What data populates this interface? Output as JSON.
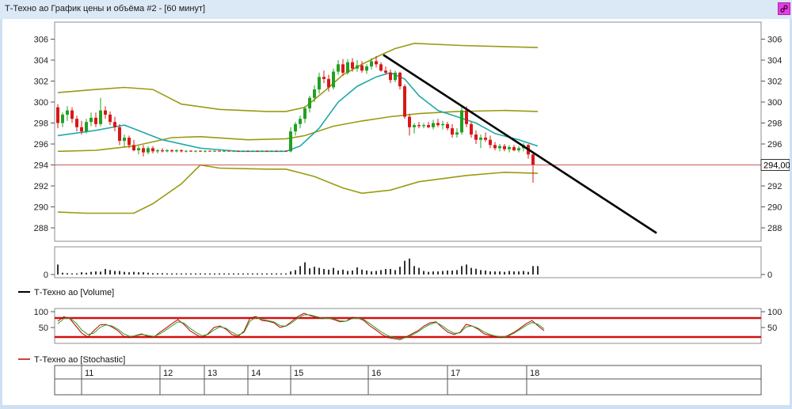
{
  "window": {
    "title": "Т-Техно ао График цены и объёма #2 - [60 минут]",
    "link_icon": "chain-link-icon",
    "link_color": "#e13fe0"
  },
  "price_panel": {
    "y_ticks": [
      "306",
      "304",
      "302",
      "300",
      "298",
      "296",
      "294",
      "292",
      "290",
      "288"
    ],
    "last_price_label": "294,00",
    "last_price_color": "#c45a5a"
  },
  "volume_panel": {
    "y_ticks": [
      "0"
    ],
    "legend_label": "Т-Техно ао [Volume]",
    "legend_color": "#000000"
  },
  "stochastic_panel": {
    "y_ticks": [
      "100",
      "50"
    ],
    "upper_level": 80,
    "lower_level": 20,
    "level_color": "#d21010",
    "legend_label": "Т-Техно ао [Stochastic]",
    "legend_color": "#c00000"
  },
  "time_axis": {
    "labels": [
      "11",
      "12",
      "13",
      "14",
      "15",
      "16",
      "17",
      "18"
    ]
  },
  "chart_data": [
    {
      "type": "candlestick",
      "title": "",
      "y_range": [
        287.5,
        307
      ],
      "x_categories": [
        "11",
        "12",
        "13",
        "14",
        "15",
        "16",
        "17",
        "18"
      ],
      "colors": {
        "up": "#22a022",
        "down": "#d81818",
        "ma": "#22a8a8",
        "bollinger": "#9a9a12",
        "trendline": "#000000"
      },
      "last_price": 294.0,
      "candles_ohlc": [
        [
          299.5,
          299.8,
          297.5,
          298.0
        ],
        [
          298.0,
          299.0,
          297.6,
          298.8
        ],
        [
          298.8,
          299.6,
          298.2,
          299.2
        ],
        [
          299.2,
          299.5,
          298.0,
          298.4
        ],
        [
          298.4,
          298.7,
          297.2,
          297.6
        ],
        [
          297.6,
          298.2,
          296.9,
          297.2
        ],
        [
          297.2,
          298.4,
          297.0,
          298.1
        ],
        [
          298.1,
          299.0,
          297.7,
          298.5
        ],
        [
          298.5,
          299.0,
          297.6,
          297.9
        ],
        [
          297.9,
          300.4,
          297.7,
          299.2
        ],
        [
          299.2,
          299.6,
          298.4,
          298.8
        ],
        [
          298.8,
          299.1,
          297.8,
          298.1
        ],
        [
          298.1,
          298.6,
          297.2,
          297.6
        ],
        [
          297.6,
          297.9,
          295.9,
          296.3
        ],
        [
          296.3,
          296.9,
          295.7,
          296.6
        ],
        [
          296.6,
          296.8,
          295.6,
          295.9
        ],
        [
          295.9,
          296.4,
          295.3,
          295.4
        ],
        [
          295.4,
          295.8,
          295.0,
          295.6
        ],
        [
          295.6,
          295.9,
          294.8,
          295.2
        ],
        [
          295.2,
          295.8,
          295.0,
          295.6
        ],
        [
          295.6,
          295.8,
          295.1,
          295.3
        ],
        [
          295.3,
          295.5,
          295.1,
          295.4
        ],
        [
          295.4,
          295.6,
          295.2,
          295.3
        ],
        [
          295.3,
          295.5,
          295.2,
          295.4
        ],
        [
          295.4,
          295.5,
          295.2,
          295.3
        ],
        [
          295.3,
          295.5,
          295.2,
          295.4
        ],
        [
          295.4,
          295.5,
          295.2,
          295.3
        ],
        [
          295.3,
          295.4,
          295.2,
          295.35
        ],
        [
          295.35,
          295.4,
          295.25,
          295.3
        ],
        [
          295.3,
          295.4,
          295.2,
          295.35
        ],
        [
          295.35,
          295.4,
          295.25,
          295.3
        ],
        [
          295.3,
          295.4,
          295.2,
          295.35
        ],
        [
          295.35,
          295.4,
          295.3,
          295.3
        ],
        [
          295.3,
          295.4,
          295.25,
          295.35
        ],
        [
          295.35,
          295.4,
          295.3,
          295.3
        ],
        [
          295.3,
          295.4,
          295.25,
          295.35
        ],
        [
          295.35,
          295.4,
          295.3,
          295.3
        ],
        [
          295.3,
          295.4,
          295.25,
          295.35
        ],
        [
          295.35,
          295.4,
          295.3,
          295.3
        ],
        [
          295.3,
          295.4,
          295.25,
          295.35
        ],
        [
          295.35,
          295.4,
          295.3,
          295.3
        ],
        [
          295.3,
          295.4,
          295.25,
          295.35
        ],
        [
          295.35,
          295.4,
          295.3,
          295.3
        ],
        [
          295.3,
          295.4,
          295.25,
          295.35
        ],
        [
          295.35,
          295.4,
          295.3,
          295.3
        ],
        [
          295.3,
          295.4,
          295.25,
          295.35
        ],
        [
          295.35,
          295.4,
          295.3,
          295.3
        ],
        [
          295.3,
          295.4,
          295.25,
          295.35
        ],
        [
          295.35,
          295.4,
          295.3,
          295.3
        ],
        [
          295.3,
          297.6,
          295.2,
          297.2
        ],
        [
          297.2,
          298.1,
          296.8,
          297.9
        ],
        [
          297.9,
          298.7,
          297.5,
          298.4
        ],
        [
          298.4,
          299.6,
          298.0,
          299.4
        ],
        [
          299.4,
          300.6,
          299.0,
          300.4
        ],
        [
          300.4,
          301.6,
          300.0,
          301.2
        ],
        [
          301.2,
          302.8,
          300.8,
          302.4
        ],
        [
          302.4,
          303.0,
          301.8,
          302.2
        ],
        [
          302.2,
          302.6,
          301.0,
          301.4
        ],
        [
          301.4,
          303.2,
          301.2,
          302.9
        ],
        [
          302.9,
          304.0,
          302.6,
          303.6
        ],
        [
          303.6,
          304.1,
          302.5,
          302.8
        ],
        [
          302.8,
          304.1,
          302.6,
          303.8
        ],
        [
          303.8,
          304.2,
          302.9,
          303.2
        ],
        [
          303.2,
          304.0,
          302.9,
          303.5
        ],
        [
          303.5,
          303.9,
          302.8,
          303.0
        ],
        [
          303.0,
          303.6,
          302.7,
          303.4
        ],
        [
          303.4,
          304.2,
          303.1,
          303.9
        ],
        [
          303.9,
          304.4,
          303.3,
          303.6
        ],
        [
          303.6,
          303.8,
          302.9,
          303.0
        ],
        [
          303.0,
          303.4,
          302.6,
          302.8
        ],
        [
          302.8,
          303.1,
          301.8,
          302.1
        ],
        [
          302.1,
          303.0,
          301.9,
          302.8
        ],
        [
          302.8,
          302.9,
          301.2,
          301.5
        ],
        [
          301.5,
          301.7,
          298.4,
          298.6
        ],
        [
          298.6,
          298.9,
          296.8,
          297.6
        ],
        [
          297.6,
          298.0,
          297.0,
          297.8
        ],
        [
          297.8,
          298.1,
          297.5,
          297.7
        ],
        [
          297.7,
          298.0,
          297.5,
          297.8
        ],
        [
          297.8,
          298.1,
          297.5,
          297.6
        ],
        [
          297.6,
          298.3,
          297.4,
          298.0
        ],
        [
          298.0,
          298.4,
          297.6,
          297.8
        ],
        [
          297.8,
          298.2,
          297.4,
          297.9
        ],
        [
          297.9,
          298.1,
          297.3,
          297.5
        ],
        [
          297.5,
          297.9,
          296.6,
          296.9
        ],
        [
          296.9,
          297.5,
          296.6,
          297.1
        ],
        [
          297.1,
          299.5,
          296.9,
          299.2
        ],
        [
          299.2,
          299.6,
          297.6,
          297.9
        ],
        [
          297.9,
          298.1,
          296.6,
          296.9
        ],
        [
          296.9,
          297.3,
          296.0,
          296.4
        ],
        [
          296.4,
          296.9,
          295.6,
          296.6
        ],
        [
          296.6,
          297.1,
          296.2,
          296.4
        ],
        [
          296.4,
          296.8,
          295.6,
          295.9
        ],
        [
          295.9,
          296.2,
          295.4,
          295.6
        ],
        [
          295.6,
          296.0,
          295.3,
          295.8
        ],
        [
          295.8,
          296.0,
          295.3,
          295.5
        ],
        [
          295.5,
          295.9,
          295.2,
          295.7
        ],
        [
          295.7,
          295.9,
          295.3,
          295.4
        ],
        [
          295.4,
          295.8,
          295.2,
          295.6
        ],
        [
          295.6,
          296.1,
          295.3,
          295.9
        ],
        [
          295.9,
          296.0,
          294.6,
          295.0
        ],
        [
          295.0,
          295.2,
          292.3,
          294.0
        ]
      ],
      "moving_average": [
        [
          0,
          296.8
        ],
        [
          8,
          297.3
        ],
        [
          14,
          297.8
        ],
        [
          22,
          296.4
        ],
        [
          30,
          295.6
        ],
        [
          38,
          295.3
        ],
        [
          48,
          295.3
        ],
        [
          51,
          295.8
        ],
        [
          55,
          297.5
        ],
        [
          59,
          300.0
        ],
        [
          63,
          301.5
        ],
        [
          67,
          302.4
        ],
        [
          70,
          302.8
        ],
        [
          73,
          302.2
        ],
        [
          76,
          300.6
        ],
        [
          80,
          299.2
        ],
        [
          84,
          298.6
        ],
        [
          88,
          298.0
        ],
        [
          92,
          297.0
        ],
        [
          97,
          296.4
        ],
        [
          101,
          295.8
        ]
      ],
      "bollinger_upper": [
        [
          0,
          300.9
        ],
        [
          8,
          301.2
        ],
        [
          14,
          301.4
        ],
        [
          20,
          301.2
        ],
        [
          26,
          299.8
        ],
        [
          34,
          299.3
        ],
        [
          44,
          299.1
        ],
        [
          48,
          299.1
        ],
        [
          52,
          299.5
        ],
        [
          56,
          301.0
        ],
        [
          60,
          302.6
        ],
        [
          64,
          303.6
        ],
        [
          68,
          304.5
        ],
        [
          71,
          305.1
        ],
        [
          75,
          305.6
        ],
        [
          85,
          305.4
        ],
        [
          101,
          305.2
        ]
      ],
      "bollinger_middle": [
        [
          0,
          295.3
        ],
        [
          8,
          295.4
        ],
        [
          16,
          295.8
        ],
        [
          24,
          296.6
        ],
        [
          30,
          296.7
        ],
        [
          40,
          296.4
        ],
        [
          48,
          296.5
        ],
        [
          52,
          296.8
        ],
        [
          58,
          297.7
        ],
        [
          64,
          298.2
        ],
        [
          70,
          298.6
        ],
        [
          76,
          298.9
        ],
        [
          84,
          299.1
        ],
        [
          94,
          299.2
        ],
        [
          101,
          299.1
        ]
      ],
      "bollinger_lower": [
        [
          0,
          289.5
        ],
        [
          6,
          289.4
        ],
        [
          16,
          289.4
        ],
        [
          20,
          290.3
        ],
        [
          26,
          292.2
        ],
        [
          30,
          294.0
        ],
        [
          34,
          293.7
        ],
        [
          44,
          293.6
        ],
        [
          48,
          293.6
        ],
        [
          54,
          292.9
        ],
        [
          60,
          291.8
        ],
        [
          64,
          291.3
        ],
        [
          70,
          291.6
        ],
        [
          76,
          292.4
        ],
        [
          86,
          293.0
        ],
        [
          94,
          293.3
        ],
        [
          101,
          293.2
        ]
      ],
      "trendline": [
        [
          68.5,
          304.5
        ],
        [
          126,
          287.5
        ]
      ]
    },
    {
      "type": "bar",
      "title": "",
      "y_range": [
        0,
        100
      ],
      "values": [
        45,
        8,
        6,
        5,
        5,
        10,
        8,
        12,
        14,
        13,
        25,
        20,
        16,
        16,
        12,
        10,
        12,
        10,
        10,
        8,
        6,
        6,
        6,
        5,
        5,
        5,
        5,
        5,
        5,
        5,
        5,
        5,
        5,
        5,
        5,
        5,
        5,
        5,
        5,
        5,
        5,
        5,
        5,
        5,
        5,
        5,
        5,
        5,
        5,
        14,
        20,
        38,
        55,
        28,
        35,
        30,
        25,
        22,
        30,
        18,
        22,
        16,
        18,
        32,
        22,
        18,
        14,
        16,
        20,
        25,
        25,
        20,
        35,
        62,
        72,
        38,
        30,
        16,
        12,
        14,
        14,
        16,
        18,
        18,
        20,
        38,
        45,
        30,
        26,
        20,
        18,
        14,
        14,
        14,
        12,
        16,
        14,
        14,
        16,
        12,
        38,
        38
      ]
    },
    {
      "type": "line",
      "title": "",
      "y_range": [
        0,
        100
      ],
      "series": [
        {
          "color": "#c00000",
          "values": [
            70,
            84,
            78,
            55,
            32,
            20,
            40,
            58,
            60,
            52,
            40,
            22,
            18,
            25,
            30,
            22,
            20,
            35,
            48,
            62,
            75,
            60,
            40,
            28,
            18,
            30,
            50,
            55,
            45,
            28,
            22,
            38,
            80,
            85,
            72,
            70,
            65,
            50,
            55,
            70,
            85,
            95,
            88,
            82,
            78,
            80,
            75,
            68,
            70,
            82,
            80,
            72,
            55,
            42,
            28,
            18,
            15,
            12,
            20,
            30,
            40,
            55,
            65,
            68,
            50,
            35,
            28,
            35,
            60,
            55,
            45,
            30,
            25,
            20,
            18,
            25,
            35,
            48,
            62,
            72,
            55,
            40
          ]
        },
        {
          "color": "#2aa02a",
          "values": [
            62,
            78,
            80,
            65,
            42,
            28,
            32,
            50,
            58,
            55,
            45,
            30,
            22,
            24,
            28,
            25,
            22,
            30,
            42,
            55,
            68,
            64,
            48,
            35,
            24,
            28,
            42,
            52,
            48,
            35,
            26,
            34,
            70,
            82,
            76,
            72,
            68,
            56,
            54,
            65,
            80,
            90,
            90,
            85,
            80,
            79,
            77,
            71,
            70,
            78,
            80,
            75,
            62,
            48,
            35,
            24,
            18,
            15,
            18,
            26,
            36,
            50,
            60,
            66,
            56,
            42,
            32,
            33,
            52,
            55,
            48,
            36,
            28,
            23,
            20,
            23,
            32,
            44,
            56,
            66,
            60,
            46
          ]
        }
      ],
      "levels": [
        80,
        20
      ]
    }
  ]
}
